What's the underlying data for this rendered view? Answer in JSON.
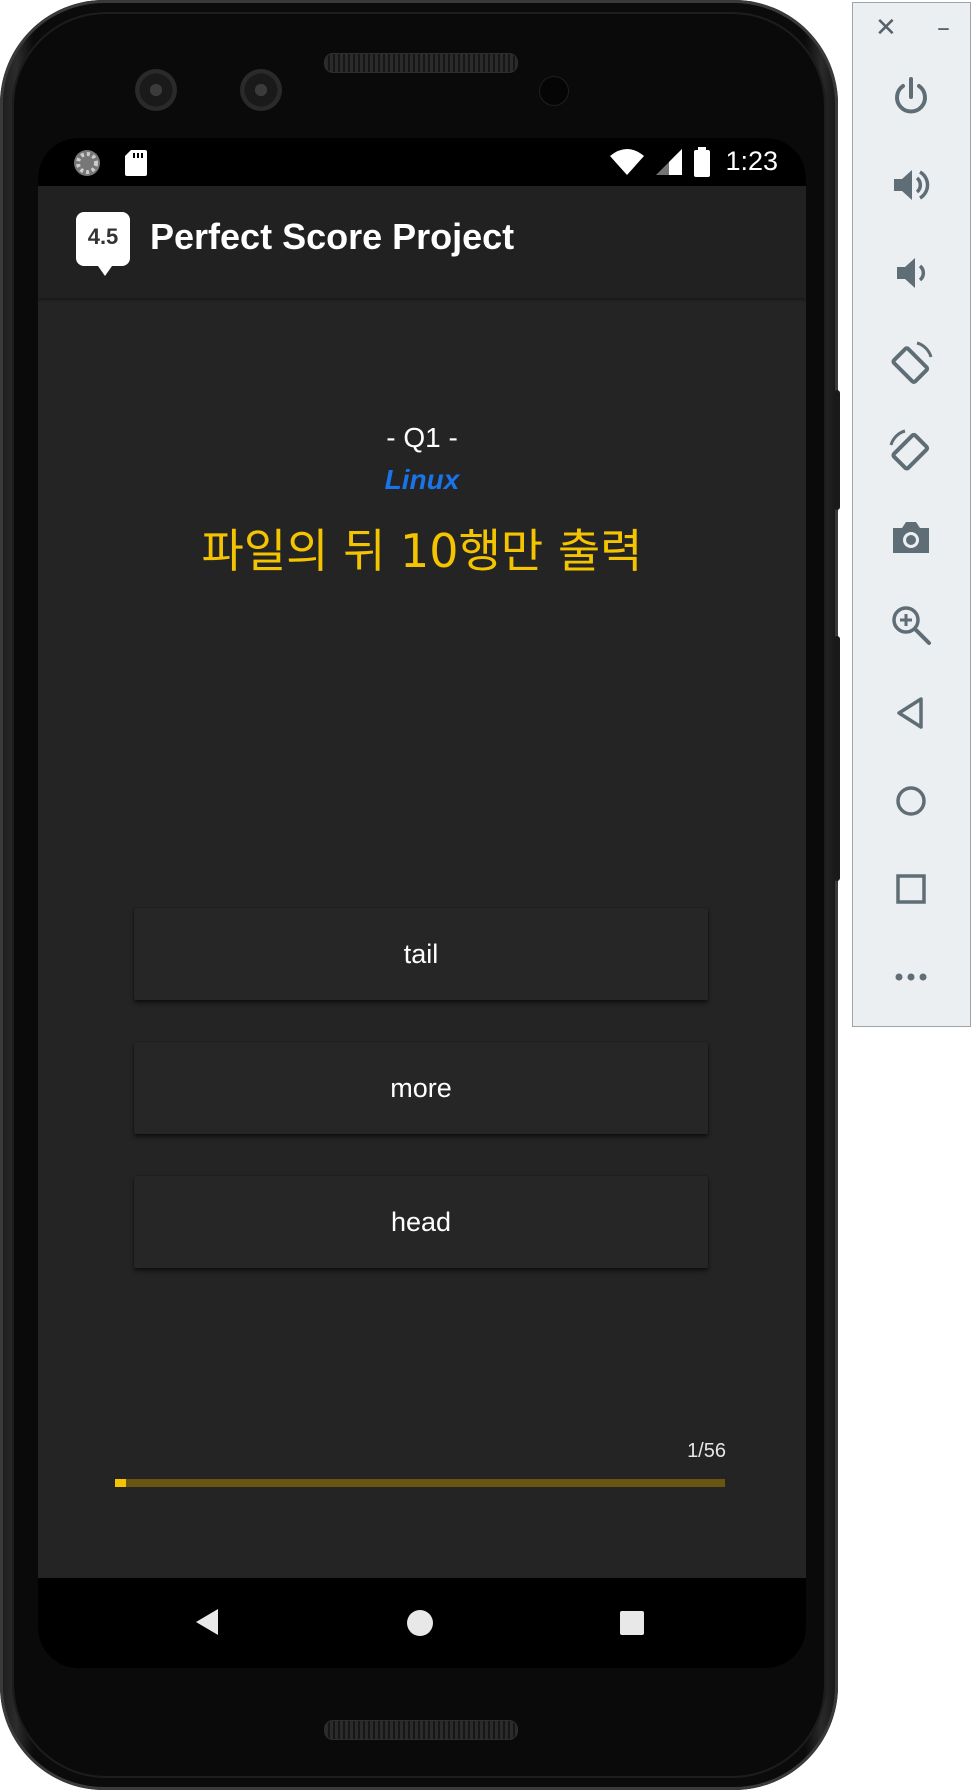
{
  "status_bar": {
    "time": "1:23"
  },
  "app_bar": {
    "icon_text": "4.5",
    "title": "Perfect Score Project"
  },
  "quiz": {
    "number": "- Q1 -",
    "category": "Linux",
    "question": "파일의 뒤 10행만 출력",
    "answers": [
      "tail",
      "more",
      "head"
    ],
    "progress_label": "1/56",
    "progress_fraction": 0.0179
  },
  "colors": {
    "background": "#242424",
    "app_bar": "#212121",
    "accent_yellow": "#f5c400",
    "category_blue": "#1a73e8",
    "progress_track": "#6b5513"
  },
  "toolbar": {
    "close_glyph": "✕",
    "minimize_glyph": "–",
    "buttons": [
      "power-icon",
      "volume-up-icon",
      "volume-down-icon",
      "rotate-left-icon",
      "rotate-right-icon",
      "camera-icon",
      "zoom-icon",
      "back-icon",
      "home-icon",
      "overview-icon",
      "more-icon"
    ]
  }
}
